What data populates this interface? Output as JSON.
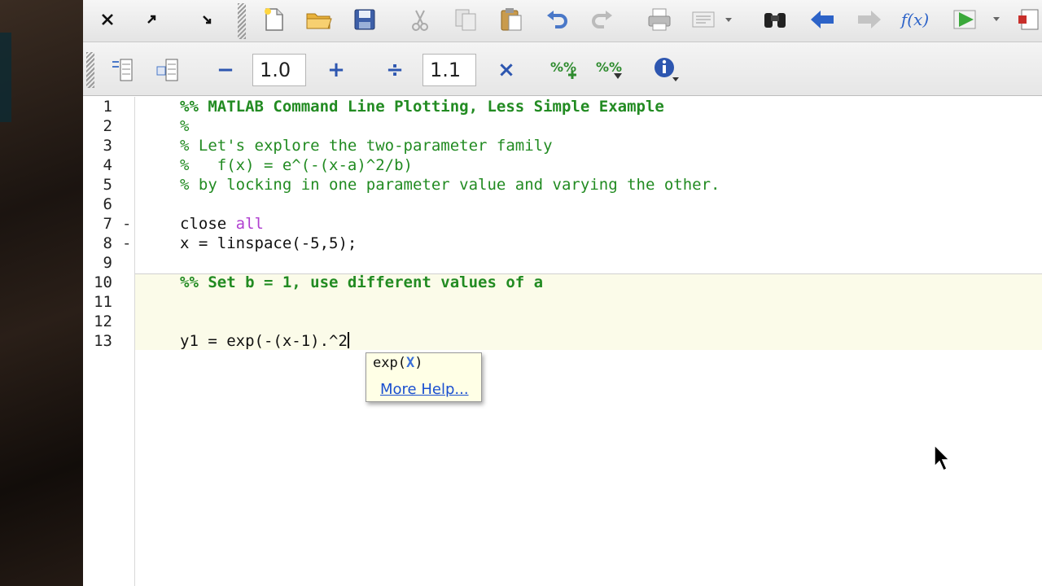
{
  "toolbar_top": {
    "icons": [
      "close-icon",
      "undock-icon",
      "dock-icon",
      "new-file-icon",
      "open-folder-icon",
      "save-icon",
      "cut-icon",
      "copy-icon",
      "paste-icon",
      "undo-icon",
      "redo-icon",
      "print-icon",
      "comment-icon",
      "find-icon",
      "back-icon",
      "forward-icon",
      "function-icon",
      "run-icon",
      "publish-icon"
    ],
    "function_label": "f(x)"
  },
  "toolbar_cell": {
    "decrement_label": "−",
    "value1": "1.0",
    "increment_label": "+",
    "divide_label": "÷",
    "value2": "1.1",
    "multiply_label": "×"
  },
  "editor": {
    "lines": [
      {
        "n": "1",
        "mark": "",
        "segments": [
          {
            "t": "%% MATLAB Command Line Plotting, Less Simple Example",
            "c": "cmb"
          }
        ]
      },
      {
        "n": "2",
        "mark": "",
        "segments": [
          {
            "t": "%",
            "c": "cm"
          }
        ]
      },
      {
        "n": "3",
        "mark": "",
        "segments": [
          {
            "t": "% Let's explore the two-parameter family",
            "c": "cm"
          }
        ]
      },
      {
        "n": "4",
        "mark": "",
        "segments": [
          {
            "t": "%   f(x) = e^(-(x-a)^2/b)",
            "c": "cm"
          }
        ]
      },
      {
        "n": "5",
        "mark": "",
        "segments": [
          {
            "t": "% by locking in one parameter value and varying the other.",
            "c": "cm"
          }
        ]
      },
      {
        "n": "6",
        "mark": "",
        "segments": []
      },
      {
        "n": "7",
        "mark": "-",
        "segments": [
          {
            "t": "close ",
            "c": ""
          },
          {
            "t": "all",
            "c": "kw"
          }
        ]
      },
      {
        "n": "8",
        "mark": "-",
        "segments": [
          {
            "t": "x = linspace(-5,5);",
            "c": ""
          }
        ]
      },
      {
        "n": "9",
        "mark": "",
        "segments": []
      },
      {
        "n": "10",
        "mark": "",
        "segments": [
          {
            "t": "%% Set b = 1, use different values of a",
            "c": "cmb"
          }
        ]
      },
      {
        "n": "11",
        "mark": "",
        "segments": []
      },
      {
        "n": "12",
        "mark": "",
        "segments": []
      },
      {
        "n": "13",
        "mark": "",
        "segments": [
          {
            "t": "y1 = exp(-(x-1).^2",
            "c": ""
          }
        ]
      }
    ]
  },
  "tooltip": {
    "func": "exp(",
    "arg": "X",
    "close": ")",
    "link": "More Help..."
  },
  "colors": {
    "comment": "#228b22",
    "keyword": "#b040d0",
    "cell_highlight": "#fbfbe9",
    "link": "#1a4fd0"
  }
}
